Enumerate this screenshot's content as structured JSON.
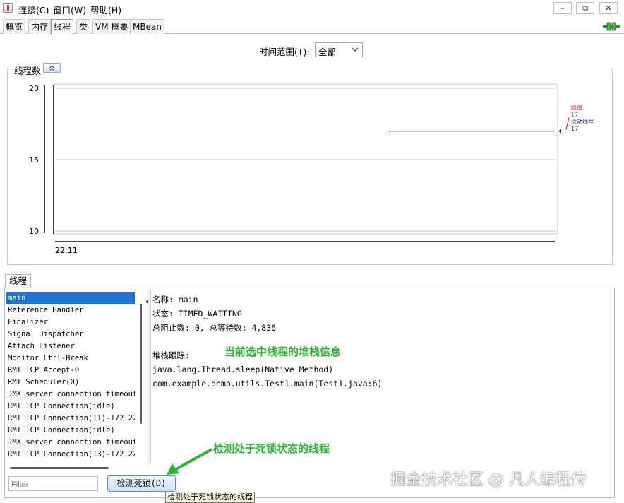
{
  "menu": {
    "connect": "连接(C)",
    "window": "窗口(W)",
    "help": "帮助(H)"
  },
  "window_buttons": {
    "minimize": "–",
    "restore": "⧉",
    "close": "✕"
  },
  "tabs": [
    "概览",
    "内存",
    "线程",
    "类",
    "VM 概要",
    "MBean"
  ],
  "active_tab": "线程",
  "time_range": {
    "label": "时间范围(T):",
    "value": "全部"
  },
  "chart": {
    "title": "线程数"
  },
  "chart_data": {
    "type": "line",
    "title": "线程数",
    "ylim": [
      10,
      20
    ],
    "y_ticks": [
      20,
      15,
      10
    ],
    "x_ticks": [
      "22:11"
    ],
    "series": [
      {
        "name": "峰值",
        "value": 17,
        "color": "#e22a2a"
      },
      {
        "name": "活动线程",
        "value": 17,
        "color": "#1c1c8c"
      }
    ],
    "legend_placement": "right"
  },
  "threads_section": {
    "tab": "线程"
  },
  "thread_list": [
    "main",
    "Reference Handler",
    "Finalizer",
    "Signal Dispatcher",
    "Attach Listener",
    "Monitor Ctrl-Break",
    "RMI TCP Accept-0",
    "RMI Scheduler(0)",
    "JMX server connection timeout",
    "RMI TCP Connection(idle)",
    "RMI TCP Connection(11)-172.22.",
    "RMI TCP Connection(idle)",
    "JMX server connection timeout",
    "RMI TCP Connection(13)-172.22."
  ],
  "selected_thread_index": 0,
  "detail": {
    "name": "名称: main",
    "state": "状态: TIMED_WAITING",
    "counts": "总阻止数: 0, 总等待数: 4,836",
    "stack_label": "堆栈跟踪:",
    "stack": [
      "java.lang.Thread.sleep(Native Method)",
      "com.example.demo.utils.Test1.main(Test1.java:6)"
    ]
  },
  "filter_placeholder": "Filter",
  "detect_button": "检测死锁(D)",
  "tooltip": "检测处于死锁状态的线程",
  "annotations": {
    "stack_info": "当前选中线程的堆栈信息",
    "deadlock": "检测处于死锁状态的线程",
    "annotation_color": "#2bb534"
  },
  "watermark": "掘金技术社区 @ 凡人编程传"
}
